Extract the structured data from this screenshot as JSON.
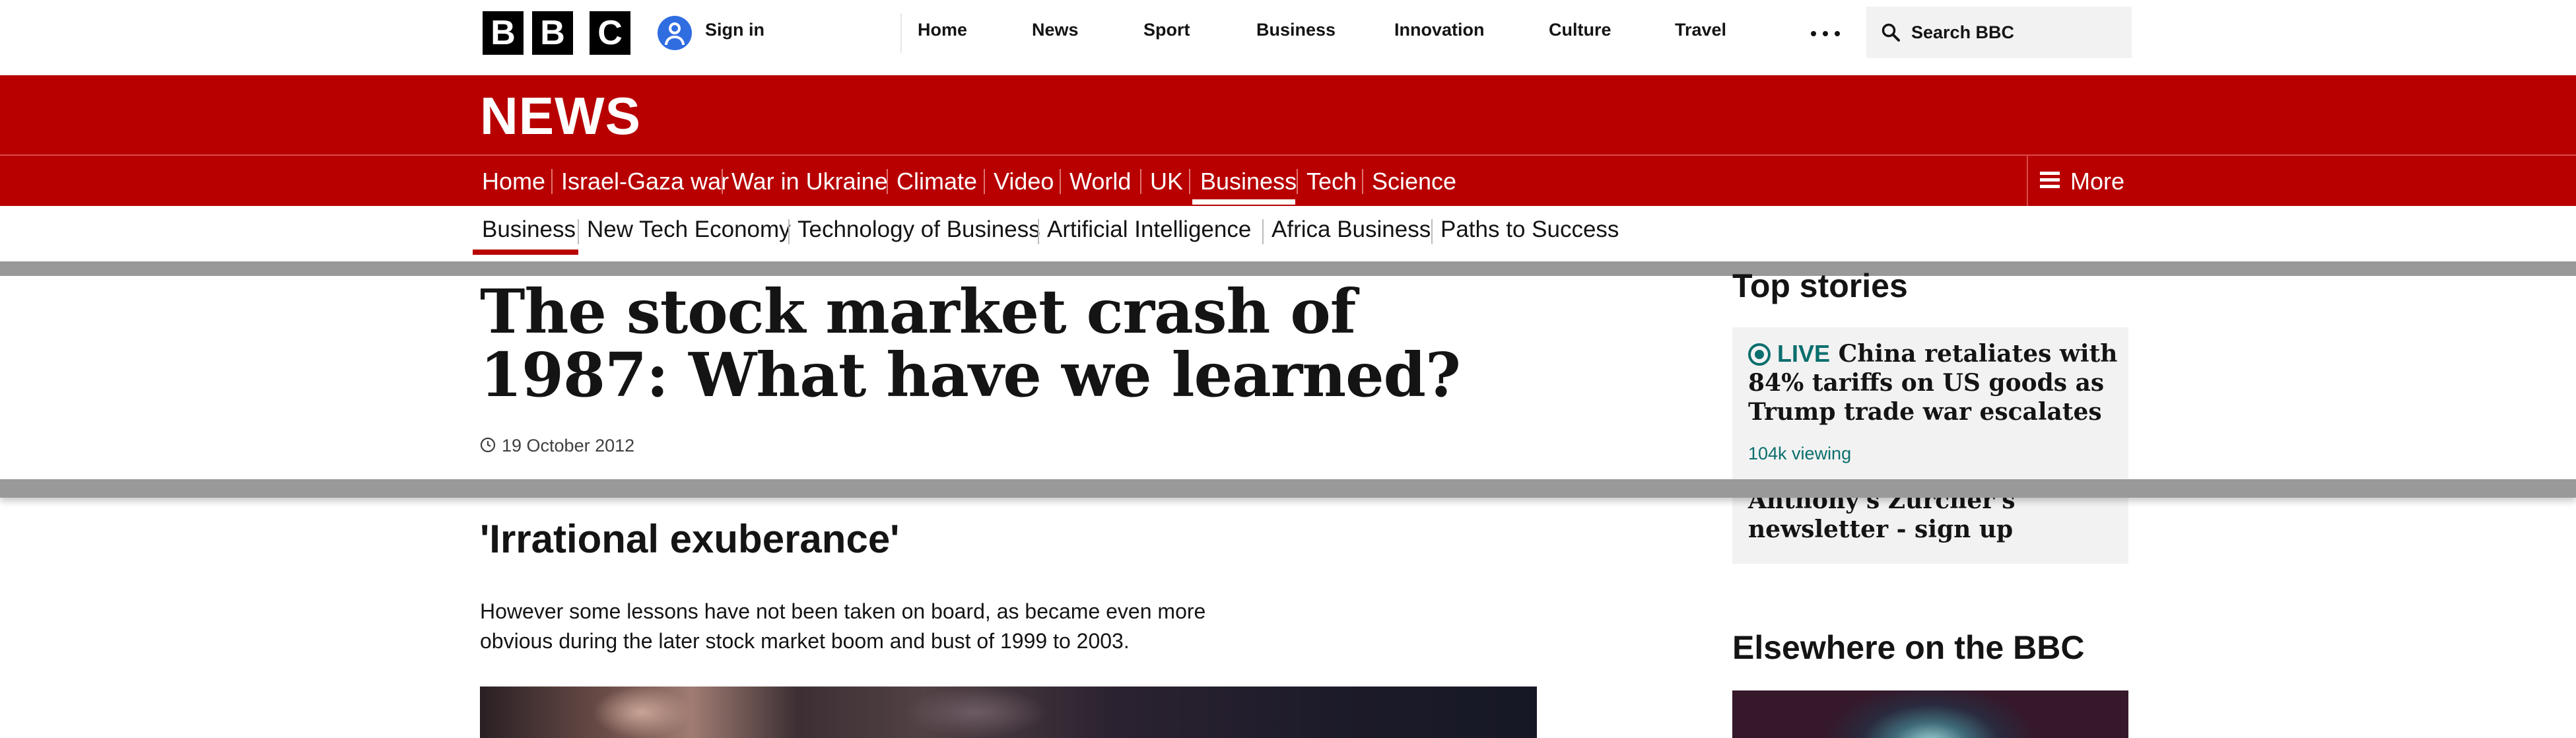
{
  "global_header": {
    "logo_letters": [
      "B",
      "B",
      "C"
    ],
    "sign_in_label": "Sign in",
    "nav_items": [
      "Home",
      "News",
      "Sport",
      "Business",
      "Innovation",
      "Culture",
      "Travel"
    ],
    "search_placeholder": "Search BBC"
  },
  "news_masthead": {
    "title": "NEWS",
    "nav_items": [
      "Home",
      "Israel-Gaza war",
      "War in Ukraine",
      "Climate",
      "Video",
      "World",
      "UK",
      "Business",
      "Tech",
      "Science"
    ],
    "active_item": "Business",
    "more_label": "More"
  },
  "sub_nav": {
    "items": [
      "Business",
      "New Tech Economy",
      "Technology of Business",
      "Artificial Intelligence",
      "Africa Business",
      "Paths to Success"
    ],
    "active_item": "Business"
  },
  "article": {
    "headline": "The stock market crash of 1987: What have we learned?",
    "date": "19 October 2012",
    "subheading": "'Irrational exuberance'",
    "paragraph": "However some lessons have not been taken on board, as became even more obvious during the later stock market boom and bust of 1999 to 2003."
  },
  "sidebar": {
    "top_stories_title": "Top stories",
    "story1": {
      "live_label": "LIVE",
      "title": "China retaliates with 84% tariffs on US goods as Trump trade war escalates",
      "viewing": "104k viewing"
    },
    "story2": {
      "title": "Anthony's Zurcher's newsletter - sign up"
    },
    "elsewhere_title": "Elsewhere on the BBC"
  },
  "colors": {
    "bbc_news_red": "#b80000",
    "live_teal": "#0a6e6e",
    "card_grey": "#f2f2f2"
  }
}
